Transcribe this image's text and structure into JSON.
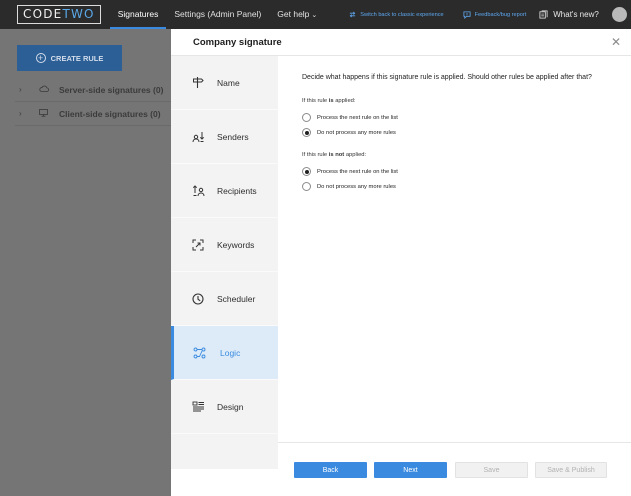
{
  "topbar": {
    "logo_left": "CODE",
    "logo_right": "TWO",
    "tabs": [
      {
        "label": "Signatures"
      },
      {
        "label": "Settings (Admin Panel)"
      },
      {
        "label": "Get help"
      }
    ],
    "switch_link": "Switch back to classic experience",
    "feedback_link": "Feedback/bug report",
    "whats_new": "What's new?"
  },
  "background": {
    "create_rule": "CREATE RULE",
    "tree": [
      {
        "label": "Server-side signatures (0)"
      },
      {
        "label": "Client-side signatures (0)"
      }
    ]
  },
  "modal": {
    "title": "Company signature",
    "steps": [
      {
        "label": "Name",
        "icon": "signpost-icon"
      },
      {
        "label": "Senders",
        "icon": "senders-icon"
      },
      {
        "label": "Recipients",
        "icon": "recipients-icon"
      },
      {
        "label": "Keywords",
        "icon": "keywords-icon"
      },
      {
        "label": "Scheduler",
        "icon": "clock-icon"
      },
      {
        "label": "Logic",
        "icon": "logic-icon"
      },
      {
        "label": "Design",
        "icon": "design-icon"
      }
    ],
    "active_step": "Logic",
    "question": "Decide what happens if this signature rule is applied. Should other rules be applied after that?",
    "group_applied": {
      "title_prefix": "If this rule ",
      "title_bold": "is",
      "title_suffix": " applied:",
      "options": [
        {
          "label": "Process the next rule on the list",
          "selected": false
        },
        {
          "label": "Do not process any more rules",
          "selected": true
        }
      ]
    },
    "group_not_applied": {
      "title_prefix": "If this rule ",
      "title_bold": "is not",
      "title_suffix": " applied:",
      "options": [
        {
          "label": "Process the next rule on the list",
          "selected": true
        },
        {
          "label": "Do not process any more rules",
          "selected": false
        }
      ]
    },
    "buttons": {
      "back": "Back",
      "next": "Next",
      "save": "Save",
      "save_publish": "Save & Publish"
    }
  },
  "colors": {
    "accent": "#3a8be0",
    "topbar": "#2b2b2b",
    "active_step_bg": "#ddebf9"
  }
}
